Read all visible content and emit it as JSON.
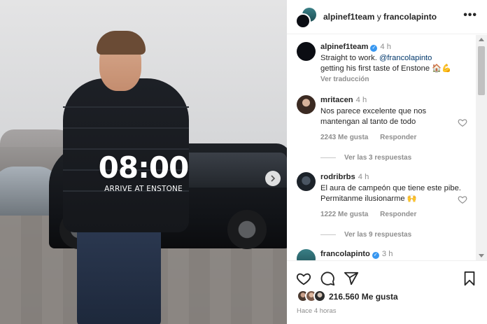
{
  "photo": {
    "overlay_time": "08:00",
    "overlay_subtitle": "ARRIVE AT ENSTONE"
  },
  "header": {
    "account1": "alpinef1team",
    "connector": "y",
    "account2": "francolapinto"
  },
  "caption": {
    "username": "alpinef1team",
    "time": "4 h",
    "text_before": "Straight to work.",
    "mention": "@francolapinto",
    "text_after": "getting his first taste of Enstone 🏠💪",
    "translate": "Ver traducción"
  },
  "comments": [
    {
      "username": "mritacen",
      "time": "4 h",
      "text": "Nos parece excelente que nos mantengan al tanto de todo",
      "likes": "2243 Me gusta",
      "reply": "Responder",
      "view_replies": "Ver las 3 respuestas"
    },
    {
      "username": "rodribrbs",
      "time": "4 h",
      "text": "El aura de campeón que tiene este pibe. Permitanme ilusionarme 🙌",
      "likes": "1222 Me gusta",
      "reply": "Responder",
      "view_replies": "Ver las 9 respuestas"
    },
    {
      "username": "francolapinto",
      "time": "3 h"
    }
  ],
  "footer": {
    "likes": "216.560 Me gusta",
    "time_ago": "Hace 4 horas"
  },
  "icons": [
    "heart-icon",
    "comment-icon",
    "share-icon",
    "bookmark-icon",
    "more-icon",
    "next-arrow-icon",
    "verified-icon"
  ],
  "colors": {
    "text": "#262626",
    "muted": "#8e8e8e",
    "link": "#00376b",
    "verified": "#3897f0"
  }
}
